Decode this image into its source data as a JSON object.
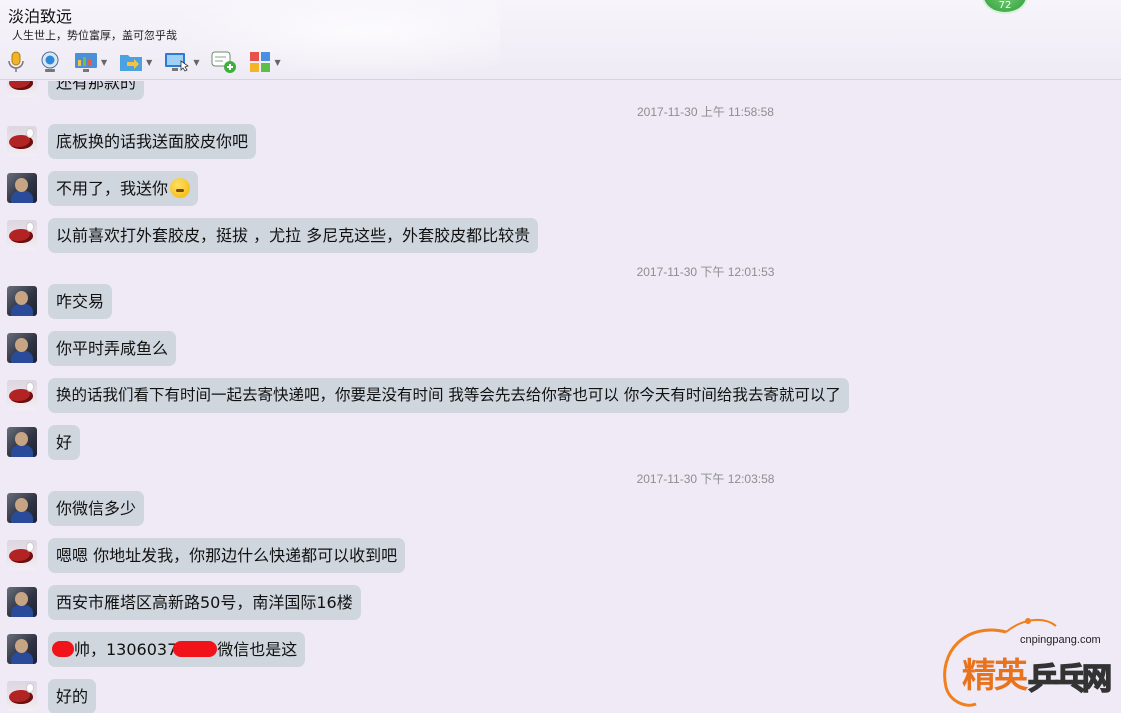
{
  "header": {
    "title": "淡泊致远",
    "signature": "人生世上，势位富厚，盖可忽乎哉",
    "level": "72",
    "toolbar": [
      {
        "name": "voice-icon"
      },
      {
        "name": "video-icon"
      },
      {
        "name": "screen-share-icon"
      },
      {
        "name": "file-transfer-icon"
      },
      {
        "name": "remote-desktop-icon"
      },
      {
        "name": "new-discussion-icon"
      },
      {
        "name": "apps-icon"
      }
    ]
  },
  "chat": {
    "partial_message": "还有那款的",
    "timestamps": [
      "2017-11-30 上午 11:58:58",
      "2017-11-30 下午 12:01:53",
      "2017-11-30 下午 12:03:58"
    ],
    "messages": [
      {
        "sender": "b",
        "text": "底板换的话我送面胶皮你吧"
      },
      {
        "sender": "a",
        "text": "不用了，我送你"
      },
      {
        "sender": "b",
        "text": "以前喜欢打外套胶皮，挺拔 ，尤拉 多尼克这些，外套胶皮都比较贵"
      },
      {
        "sender": "a",
        "text": "咋交易"
      },
      {
        "sender": "a",
        "text": "你平时弄咸鱼么"
      },
      {
        "sender": "b",
        "text": "换的话我们看下有时间一起去寄快递吧，你要是没有时间 我等会先去给你寄也可以 你今天有时间给我去寄就可以了"
      },
      {
        "sender": "a",
        "text": "好"
      },
      {
        "sender": "a",
        "text": "你微信多少"
      },
      {
        "sender": "b",
        "text": "嗯嗯 你地址发我，你那边什么快递都可以收到吧"
      },
      {
        "sender": "a",
        "text": "西安市雁塔区高新路50号，南洋国际16楼"
      },
      {
        "sender": "a",
        "text_prefix": "帅，1306037",
        "text_suffix": "微信也是这"
      },
      {
        "sender": "b",
        "text": "好的"
      }
    ]
  },
  "watermark": {
    "url": "cnpingpang.com",
    "brand_1": "精英",
    "brand_2": "乒乓网"
  },
  "colors": {
    "background": "#efeaf6",
    "bubble": "#cfd6de",
    "timestamp": "#8e8e8e",
    "redaction": "#f0141a",
    "watermark_orange": "#e9731d"
  }
}
